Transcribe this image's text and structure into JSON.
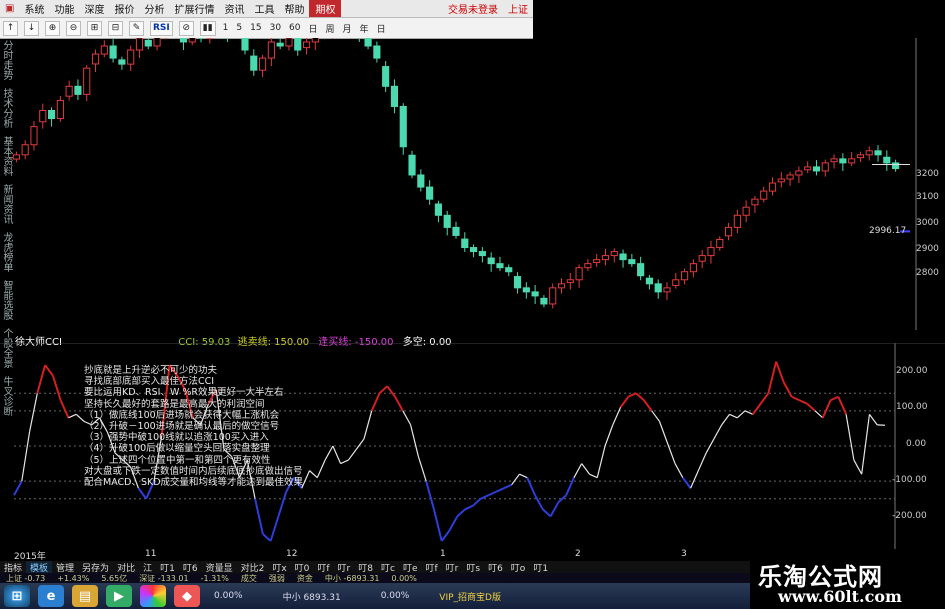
{
  "menu": {
    "items": [
      "系统",
      "功能",
      "深度",
      "报价",
      "分析",
      "扩展行情",
      "资讯",
      "工具",
      "帮助"
    ],
    "active": "期权",
    "right": [
      "交易未登录",
      "上证"
    ]
  },
  "toolbar": {
    "left_labels": [
      "↑",
      "↓",
      "⊕",
      "⊖",
      "⊞",
      "⊟",
      "✎",
      "RSI",
      "⊘",
      "▮▮"
    ],
    "periods": [
      "1",
      "5",
      "15",
      "30",
      "60",
      "日"
    ],
    "right_labels": [
      "周",
      "月",
      "年",
      "日"
    ]
  },
  "left_tabs": [
    "分时走势",
    "技术分析",
    "基本资料",
    "新闻资讯",
    "龙虎榜单",
    "智能选股",
    "个股全景",
    "牛叉诊断"
  ],
  "price_axis": {
    "ticks": [
      "3200",
      "3100",
      "3000",
      "2900",
      "2800"
    ],
    "last_price": "2996.17"
  },
  "cci": {
    "name": "徐大师CCI",
    "cci_label": "CCI:",
    "cci_value": "59.03",
    "sell_label": "逃卖线:",
    "sell_value": "150.00",
    "buy_label": "逢买线:",
    "buy_value": "-150.00",
    "bullbear_label": "多空:",
    "bullbear_value": "0.00",
    "axis_ticks": [
      "200.00",
      "100.00",
      "0.00",
      "-100.00",
      "-200.00"
    ],
    "colors": {
      "normal": "#e6e6e6",
      "overbought": "#d42020",
      "oversold": "#2d3fd8",
      "cci": "#9acd32",
      "sell": "#d4d422",
      "buy": "#e040e0"
    }
  },
  "annotation_lines": [
    "抄底就是上升逆必不可少的功夫",
    "寻找底部底部买入最佳方法CCI",
    "要比运用KD、RSI、W %R效果更好一大半左右",
    "坚持长久最好的套路是最高最大的利润空间",
    "（1）做底线100后进场就会获得大幅上涨机会",
    "（2）升破－100进场就是确认最后的做空信号",
    "（3）强势中破100线就以追涨100买入进入",
    "（4）升破100后做以缩量空头回落实盘整理",
    "（5）上述四个位置中第一和第四个更有效性",
    "对大盘或下跌一定数值时间内后续底底抄底做出信号",
    "配合MACD、SKD成交量和均线等才能达到最佳效果"
  ],
  "x_axis": [
    "2015年",
    "11",
    "12",
    "1",
    "2",
    "3"
  ],
  "bottom_tabs": [
    "指标",
    "模板",
    "管理",
    "另存为",
    "对比",
    "江",
    "叮1",
    "叮6",
    "资量显",
    "对比2",
    "叮x",
    "叮0",
    "叮f",
    "叮r",
    "叮8",
    "叮c",
    "叮e",
    "叮f",
    "叮r",
    "叮s",
    "叮6",
    "叮o",
    "叮1"
  ],
  "status": [
    "上证 -0.73",
    "+1.43%",
    "5.65亿",
    "深证 -133.01",
    "-1.31%",
    "成交",
    "强弱",
    "资金",
    "中小 -6893.31",
    "0.00%"
  ],
  "taskbar": [
    "0.00%",
    "中小 6893.31",
    "0.00%",
    "VIP_招商宝D版"
  ],
  "watermark": {
    "title": "乐淘公式网",
    "url": "www.60lt.com"
  },
  "chart_data": [
    {
      "type": "candlestick",
      "title": "",
      "xlabel": "",
      "ylabel": "",
      "ylim": [
        2650,
        3300
      ],
      "categories": [
        "2015年",
        "11",
        "12",
        "1",
        "2",
        "3"
      ],
      "last_price": 2996.17,
      "closes": [
        3030,
        3055,
        3100,
        3140,
        3120,
        3165,
        3200,
        3180,
        3245,
        3280,
        3300,
        3270,
        3255,
        3290,
        3320,
        3300,
        3330,
        3335,
        3350,
        3310,
        3345,
        3320,
        3340,
        3360,
        3330,
        3350,
        3290,
        3240,
        3270,
        3310,
        3300,
        3320,
        3290,
        3310,
        3330,
        3325,
        3340,
        3350,
        3360,
        3330,
        3300,
        3270,
        3200,
        3150,
        3050,
        2980,
        2950,
        2920,
        2880,
        2850,
        2830,
        2800,
        2790,
        2780,
        2760,
        2750,
        2740,
        2700,
        2690,
        2680,
        2660,
        2700,
        2710,
        2720,
        2750,
        2760,
        2770,
        2780,
        2790,
        2770,
        2760,
        2730,
        2710,
        2690,
        2700,
        2720,
        2740,
        2760,
        2780,
        2800,
        2820,
        2850,
        2880,
        2900,
        2920,
        2940,
        2960,
        2970,
        2980,
        2990,
        3000,
        2990,
        3010,
        3020,
        3010,
        3020,
        3030,
        3040,
        3030,
        3010,
        2996
      ]
    },
    {
      "type": "line",
      "title": "徐大师CCI",
      "xlabel": "",
      "ylabel": "",
      "ylim": [
        -270,
        270
      ],
      "series": [
        {
          "name": "CCI",
          "values": [
            -140,
            -100,
            40,
            150,
            230,
            200,
            130,
            80,
            90,
            70,
            60,
            80,
            40,
            -20,
            -40,
            -60,
            -120,
            -150,
            -100,
            30,
            230,
            200,
            160,
            80,
            60,
            120,
            160,
            -10,
            -30,
            -90,
            -40,
            -150,
            -250,
            -270,
            -200,
            -130,
            -90,
            -120,
            -70,
            -90,
            -40,
            0,
            -50,
            -40,
            -10,
            20,
            100,
            150,
            170,
            140,
            100,
            60,
            -30,
            -100,
            -180,
            -270,
            -240,
            -200,
            -180,
            -170,
            -150,
            -140,
            -130,
            -120,
            -110,
            -80,
            -90,
            -140,
            -180,
            -200,
            -160,
            -140,
            -90,
            -50,
            -80,
            -90,
            0,
            60,
            110,
            140,
            150,
            130,
            100,
            70,
            10,
            -50,
            -90,
            -120,
            -70,
            -20,
            20,
            60,
            90,
            80,
            100,
            90,
            120,
            150,
            240,
            180,
            140,
            130,
            120,
            100,
            80,
            130,
            140,
            90,
            -40,
            -80,
            90,
            60,
            59
          ]
        }
      ]
    }
  ]
}
